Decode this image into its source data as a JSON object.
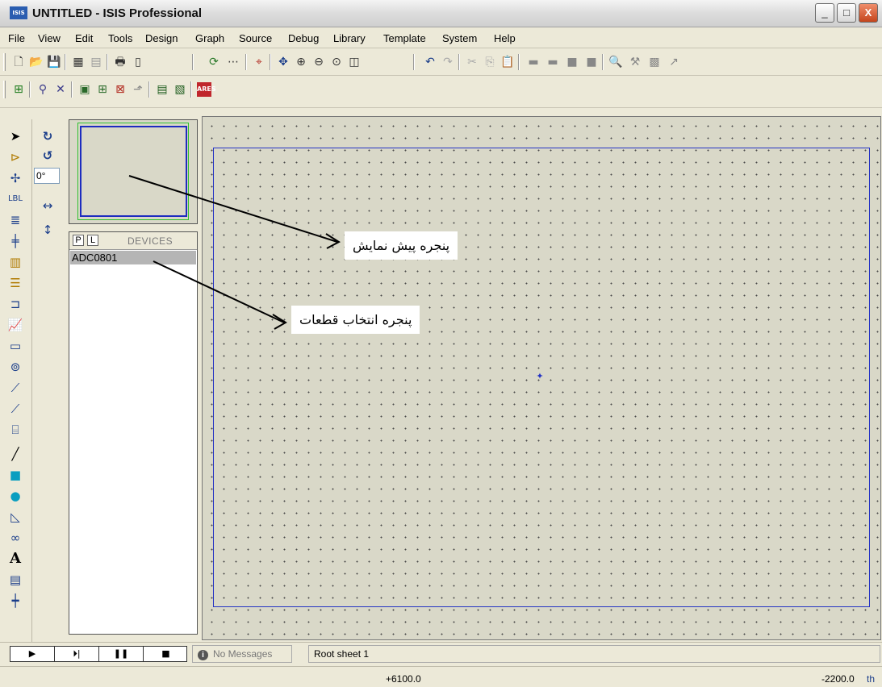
{
  "window": {
    "title": "UNTITLED - ISIS Professional",
    "app_icon_text": "ISIS"
  },
  "title_buttons": {
    "minimize": "_",
    "maximize": "□",
    "close": "X"
  },
  "menu": [
    "File",
    "View",
    "Edit",
    "Tools",
    "Design",
    "Graph",
    "Source",
    "Debug",
    "Library",
    "Template",
    "System",
    "Help"
  ],
  "left_tools": [
    "selection-mode",
    "component-mode",
    "junction-dot",
    "wire-label",
    "text-script",
    "buses",
    "subcircuit",
    "terminals",
    "device-pins",
    "graph",
    "tape-recorder",
    "generator",
    "voltage-probe",
    "current-probe",
    "virtual-instruments",
    "line",
    "box",
    "circle",
    "arc",
    "path",
    "text",
    "symbol"
  ],
  "rotation": {
    "angle_value": "0°"
  },
  "devices_panel": {
    "p_button": "P",
    "l_button": "L",
    "header": "DEVICES",
    "items": [
      "ADC0801"
    ]
  },
  "annotations": {
    "preview_window": "پنجره پیش نمایش",
    "component_selector": "پنجره انتخاب قطعات"
  },
  "bottom": {
    "messages": "No Messages",
    "sheet": "Root sheet 1"
  },
  "status": {
    "x_coord": "+6100.0",
    "y_coord": "-2200.0",
    "unit": "th"
  },
  "colors": {
    "sheet_border": "#2433c4",
    "preview_green": "#2fc02f",
    "canvas_bg": "#d9d8c8"
  }
}
